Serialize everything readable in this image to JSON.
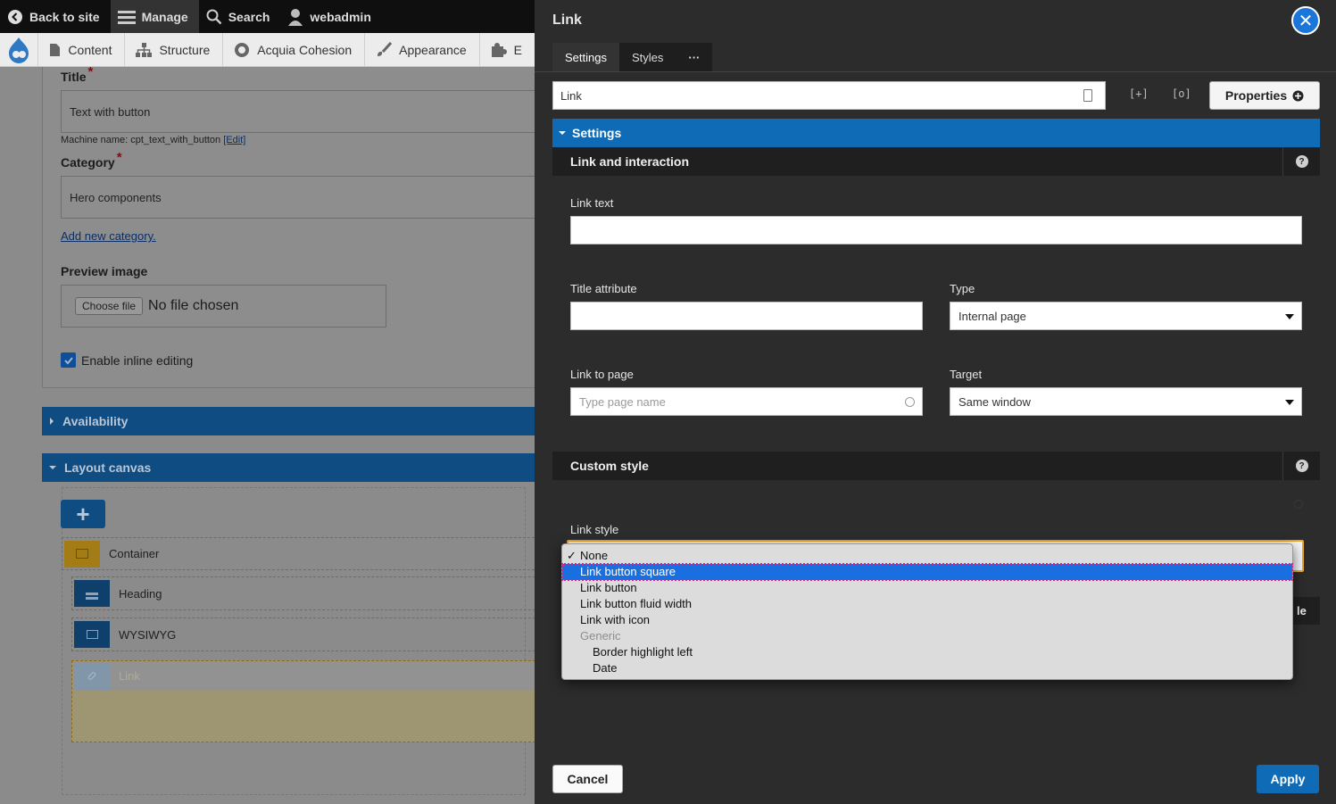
{
  "toolbar": {
    "back": "Back to site",
    "manage": "Manage",
    "search": "Search",
    "user": "webadmin"
  },
  "menu": {
    "items": [
      "Content",
      "Structure",
      "Acquia Cohesion",
      "Appearance",
      "E"
    ]
  },
  "form": {
    "title_label": "Title",
    "title_value": "Text with button",
    "machine_name": "Machine name: cpt_text_with_button",
    "edit_link": "[Edit]",
    "category_label": "Category",
    "category_value": "Hero components",
    "add_category": "Add new category.",
    "preview_label": "Preview image",
    "choose_file": "Choose file",
    "no_file": "No file chosen",
    "inline_editing": "Enable inline editing",
    "availability": "Availability",
    "layout_canvas": "Layout canvas",
    "add_symbol": "+",
    "components": [
      "Container",
      "Heading",
      "WYSIWYG",
      "Link"
    ]
  },
  "modal": {
    "title": "Link",
    "tabs": [
      "Settings",
      "Styles",
      "···"
    ],
    "name_value": "Link",
    "btn_a": "[+]",
    "btn_b": "[o]",
    "properties": "Properties",
    "settings_bar": "Settings",
    "section_link": "Link and interaction",
    "link_text_label": "Link text",
    "link_text_value": "",
    "title_attr_label": "Title attribute",
    "title_attr_value": "",
    "type_label": "Type",
    "type_value": "Internal page",
    "link_to_page_label": "Link to page",
    "link_to_page_placeholder": "Type page name",
    "target_label": "Target",
    "target_value": "Same window",
    "section_custom": "Custom style",
    "link_style_label": "Link style",
    "partial_text": "le",
    "cancel": "Cancel",
    "apply": "Apply"
  },
  "dropdown": {
    "options": [
      "None",
      "Link button square",
      "Link button",
      "Link button fluid width",
      "Link with icon"
    ],
    "group_label": "Generic",
    "group_options": [
      "Border highlight left",
      "Date"
    ],
    "checked": "None",
    "highlighted": "Link button square"
  },
  "colors": {
    "accent_blue": "#0f6bb5",
    "highlight": "#1a6fe0",
    "focus_ring": "#e8a82a",
    "required": "#a10000"
  }
}
